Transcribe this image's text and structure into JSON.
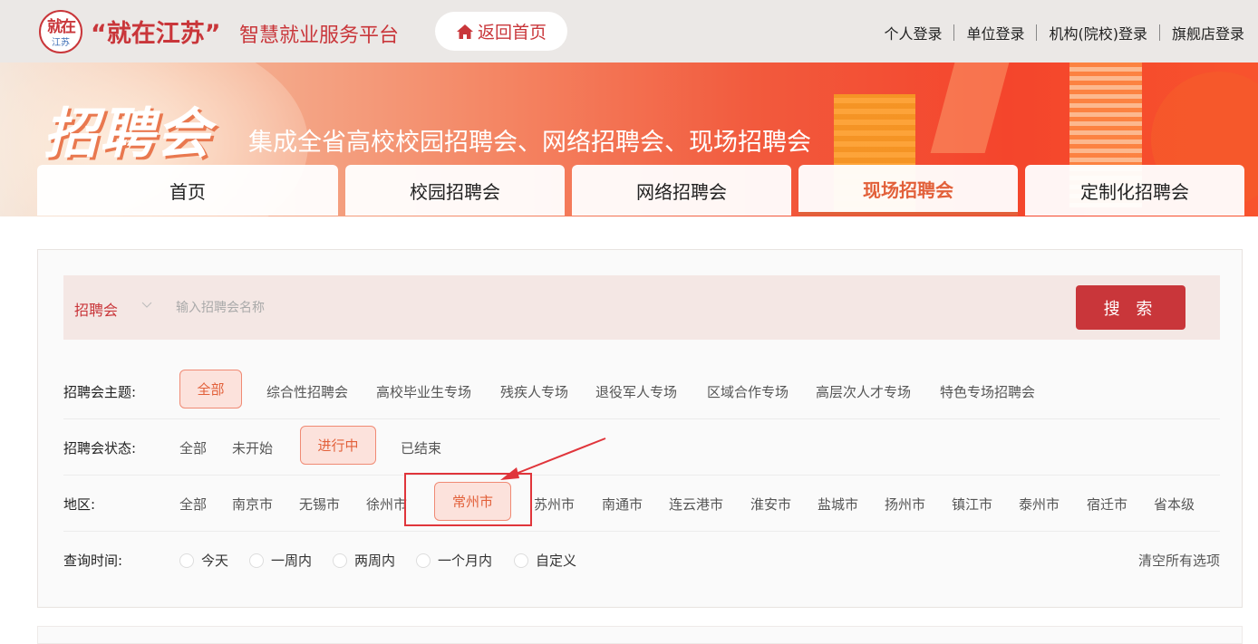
{
  "header": {
    "logo_text_top": "就在",
    "logo_text_bottom": "江苏",
    "brand": "“就在江苏”",
    "brand_sub": "智慧就业服务平台",
    "home_button": "返回首页",
    "logins": [
      "个人登录",
      "单位登录",
      "机构(院校)登录",
      "旗舰店登录"
    ]
  },
  "banner": {
    "title": "招聘会",
    "subtitle": "集成全省高校校园招聘会、网络招聘会、现场招聘会"
  },
  "tabs": [
    {
      "label": "首页",
      "active": false
    },
    {
      "label": "校园招聘会",
      "active": false
    },
    {
      "label": "网络招聘会",
      "active": false
    },
    {
      "label": "现场招聘会",
      "active": true
    },
    {
      "label": "定制化招聘会",
      "active": false
    }
  ],
  "search": {
    "type_label": "招聘会",
    "placeholder": "输入招聘会名称",
    "button": "搜 索"
  },
  "filters": {
    "theme": {
      "label": "招聘会主题:",
      "options": [
        "全部",
        "综合性招聘会",
        "高校毕业生专场",
        "残疾人专场",
        "退役军人专场",
        "区域合作专场",
        "高层次人才专场",
        "特色专场招聘会"
      ],
      "selected": "全部"
    },
    "status": {
      "label": "招聘会状态:",
      "options": [
        "全部",
        "未开始",
        "进行中",
        "已结束"
      ],
      "selected": "进行中"
    },
    "region": {
      "label": "地区:",
      "options": [
        "全部",
        "南京市",
        "无锡市",
        "徐州市",
        "常州市",
        "苏州市",
        "南通市",
        "连云港市",
        "淮安市",
        "盐城市",
        "扬州市",
        "镇江市",
        "泰州市",
        "宿迁市",
        "省本级"
      ],
      "selected": "常州市"
    },
    "time": {
      "label": "查询时间:",
      "options": [
        "今天",
        "一周内",
        "两周内",
        "一个月内",
        "自定义"
      ],
      "clear": "清空所有选项"
    }
  },
  "colors": {
    "brand_red": "#c9363a",
    "accent_orange": "#e2603a",
    "selected_bg": "#fce2dc"
  }
}
